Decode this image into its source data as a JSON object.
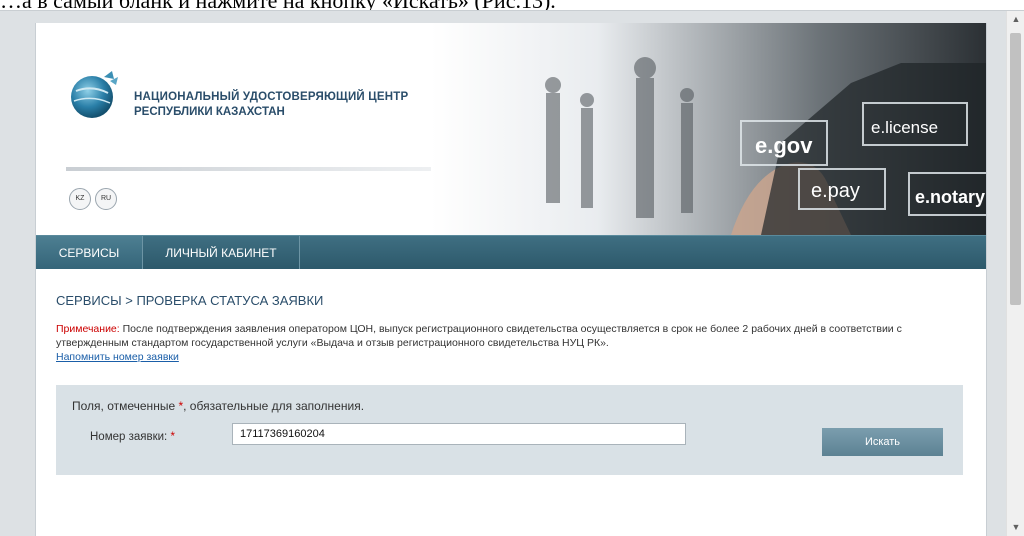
{
  "document_text": "…а в самый бланк и нажмите на кнопку «Искать» (Рис.13).",
  "header": {
    "org_line1": "НАЦИОНАЛЬНЫЙ УДОСТОВЕРЯЮЩИЙ ЦЕНТР",
    "org_line2": "РЕСПУБЛИКИ КАЗАХСТАН",
    "lang_kz": "KZ",
    "lang_ru": "RU",
    "banner_tiles": [
      "e.license",
      "e.gov",
      "e.pay",
      "e.notary"
    ]
  },
  "nav": {
    "items": [
      {
        "label": "СЕРВИСЫ"
      },
      {
        "label": "ЛИЧНЫЙ КАБИНЕТ"
      }
    ]
  },
  "content": {
    "breadcrumb": "СЕРВИСЫ > ПРОВЕРКА СТАТУСА ЗАЯВКИ",
    "note_label": "Примечание:",
    "note_text": " После подтверждения заявления оператором ЦОН, выпуск регистрационного свидетельства осуществляется в срок не более 2 рабочих дней в соответствии с утвержденным стандартом государственной услуги «Выдача и отзыв регистрационного свидетельства НУЦ РК».",
    "remind_link": "Напомнить номер заявки"
  },
  "form": {
    "required_note_prefix": "Поля, отмеченные ",
    "required_star": "*",
    "required_note_suffix": ", обязательные для заполнения.",
    "field_label": "Номер заявки:",
    "field_star": "*",
    "field_value": "17117369160204",
    "search_button": "Искать"
  },
  "colors": {
    "nav_bg": "#2c586a",
    "accent_text": "#2a4d6a",
    "required": "#cc0000",
    "link": "#1a5ea8",
    "form_bg": "#d9e1e6",
    "button_bg": "#5c8293"
  }
}
